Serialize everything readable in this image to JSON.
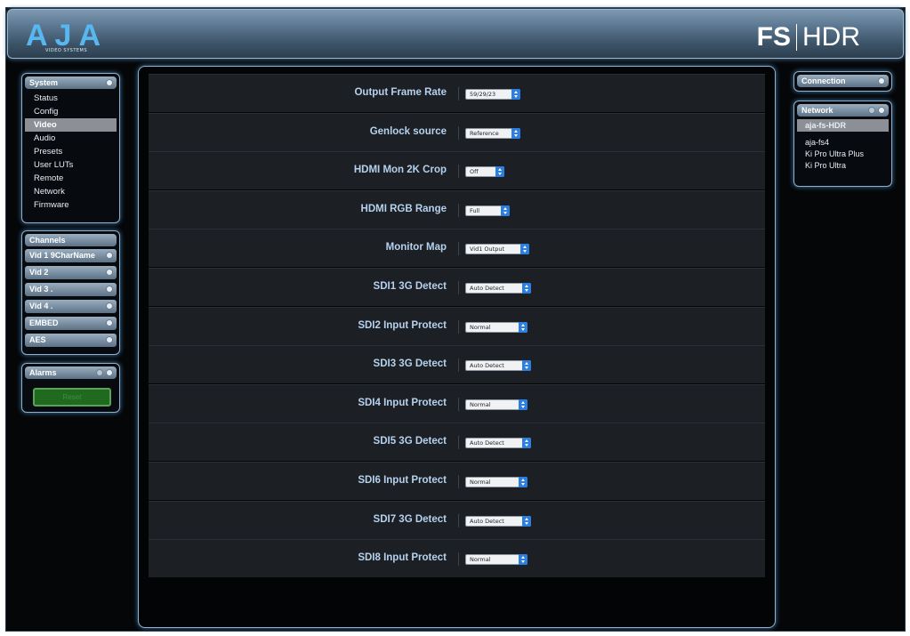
{
  "header": {
    "logo_text": "AJA",
    "logo_subtitle": "VIDEO SYSTEMS",
    "product_left": "FS",
    "product_right": "HDR"
  },
  "system_panel": {
    "title": "System",
    "items": [
      "Status",
      "Config",
      "Video",
      "Audio",
      "Presets",
      "User LUTs",
      "Remote",
      "Network",
      "Firmware"
    ],
    "active_index": 2
  },
  "channels_panel": {
    "title": "Channels",
    "items": [
      "Vid 1 9CharName",
      "Vid 2",
      "Vid 3 .",
      "Vid 4 .",
      "EMBED",
      "AES"
    ]
  },
  "alarms_panel": {
    "title": "Alarms",
    "reset_label": "Reset"
  },
  "connection_panel": {
    "title": "Connection"
  },
  "network_panel": {
    "title": "Network",
    "selected": "aja-fs-HDR",
    "devices": [
      "aja-fs4",
      "Ki Pro Ultra Plus",
      "Ki Pro Ultra"
    ]
  },
  "video_settings": [
    {
      "label": "Output Frame Rate",
      "value": "59/29/23"
    },
    {
      "label": "Genlock source",
      "value": "Reference"
    },
    {
      "label": "HDMI Mon 2K Crop",
      "value": "Off"
    },
    {
      "label": "HDMI RGB Range",
      "value": "Full"
    },
    {
      "label": "Monitor Map",
      "value": "Vid1 Output"
    },
    {
      "label": "SDI1 3G Detect",
      "value": "Auto Detect"
    },
    {
      "label": "SDI2 Input Protect",
      "value": "Normal"
    },
    {
      "label": "SDI3 3G Detect",
      "value": "Auto Detect"
    },
    {
      "label": "SDI4 Input Protect",
      "value": "Normal"
    },
    {
      "label": "SDI5 3G Detect",
      "value": "Auto Detect"
    },
    {
      "label": "SDI6 Input Protect",
      "value": "Normal"
    },
    {
      "label": "SDI7 3G Detect",
      "value": "Auto Detect"
    },
    {
      "label": "SDI8 Input Protect",
      "value": "Normal"
    }
  ],
  "colors": {
    "accent": "#2b7fe0",
    "label_blue": "#b5d1ee",
    "panel_glow": "#3f77a6",
    "reset_green": "#1f6a1f"
  }
}
